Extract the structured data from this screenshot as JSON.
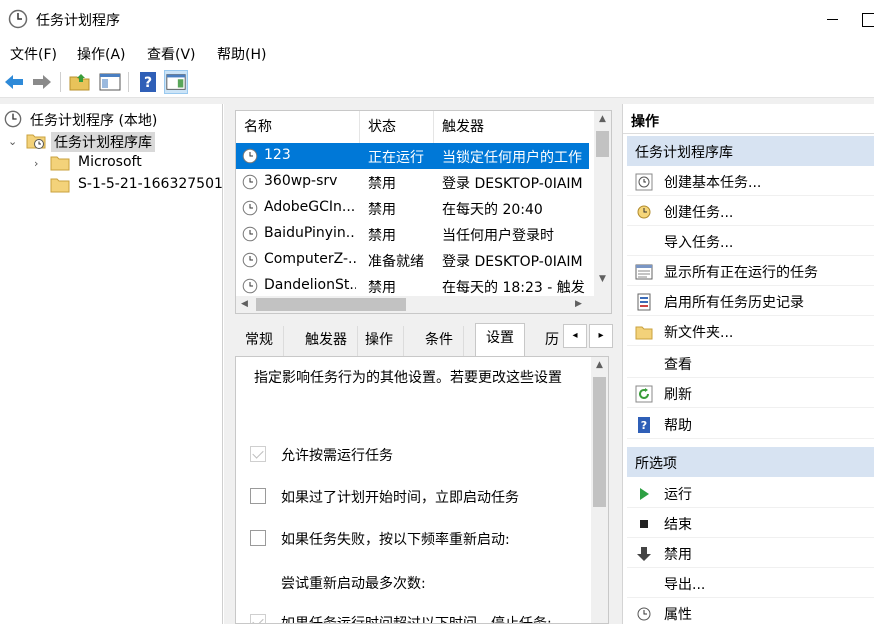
{
  "window": {
    "title": "任务计划程序"
  },
  "menu": [
    "文件(F)",
    "操作(A)",
    "查看(V)",
    "帮助(H)"
  ],
  "tree": {
    "root": "任务计划程序 (本地)",
    "library": "任务计划程序库",
    "children": [
      "Microsoft",
      "S-1-5-21-166327501"
    ]
  },
  "tasklist": {
    "columns": [
      "名称",
      "状态",
      "触发器"
    ],
    "rows": [
      {
        "name": "123",
        "status": "正在运行",
        "trigger": "当锁定任何用户的工作"
      },
      {
        "name": "360wp-srv",
        "status": "禁用",
        "trigger": "登录 DESKTOP-0IAIM"
      },
      {
        "name": "AdobeGCIn...",
        "status": "禁用",
        "trigger": "在每天的 20:40"
      },
      {
        "name": "BaiduPinyin...",
        "status": "禁用",
        "trigger": "当任何用户登录时"
      },
      {
        "name": "ComputerZ-...",
        "status": "准备就绪",
        "trigger": "登录 DESKTOP-0IAIM"
      },
      {
        "name": "DandelionSt...",
        "status": "禁用",
        "trigger": "在每天的 18:23 - 触发"
      }
    ]
  },
  "props": {
    "tabs": [
      "常规",
      "触发器",
      "操作",
      "条件",
      "设置",
      "历"
    ],
    "active_tab": "设置",
    "description": "指定影响任务行为的其他设置。若要更改这些设置",
    "options": [
      {
        "label": "允许按需运行任务",
        "checked": true
      },
      {
        "label": "如果过了计划开始时间，立即启动任务",
        "checked": false
      },
      {
        "label": "如果任务失败，按以下频率重新启动:",
        "checked": false
      },
      {
        "label": "尝试重新启动最多次数:",
        "checked": null
      },
      {
        "label": "如果任务运行时间超过以下时间，停止任务:",
        "checked": true
      }
    ]
  },
  "actions": {
    "title": "操作",
    "section1": "任务计划程序库",
    "items1": [
      "创建基本任务...",
      "创建任务...",
      "导入任务...",
      "显示所有正在运行的任务",
      "启用所有任务历史记录",
      "新文件夹...",
      "查看",
      "刷新",
      "帮助"
    ],
    "section2": "所选项",
    "items2": [
      "运行",
      "结束",
      "禁用",
      "导出...",
      "属性"
    ]
  },
  "colors": {
    "selection": "#0078d7",
    "section_header": "#d7e3f2"
  }
}
